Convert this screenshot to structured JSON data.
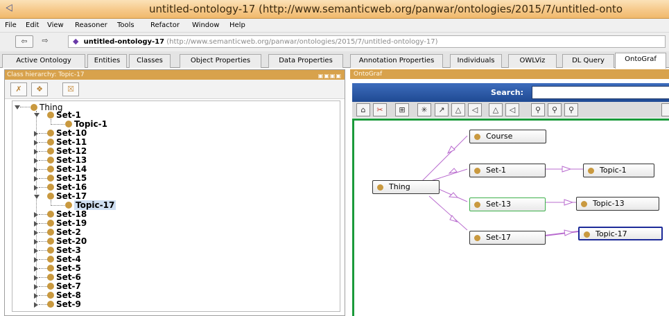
{
  "window": {
    "title": "untitled-ontology-17 (http://www.semanticweb.org/panwar/ontologies/2015/7/untitled-onto"
  },
  "menu": [
    "File",
    "Edit",
    "View",
    "Reasoner",
    "Tools",
    "Refactor",
    "Window",
    "Help"
  ],
  "address": {
    "back_icon": "⇦",
    "forward_icon": "⇨",
    "ontology_name": "untitled-ontology-17",
    "ontology_iri": "(http://www.semanticweb.org/panwar/ontologies/2015/7/untitled-ontology-17)"
  },
  "tabs": [
    {
      "label": "Active Ontology"
    },
    {
      "label": "Entities"
    },
    {
      "label": "Classes"
    },
    {
      "label": "Object Properties"
    },
    {
      "label": "Data Properties"
    },
    {
      "label": "Annotation Properties"
    },
    {
      "label": "Individuals"
    },
    {
      "label": "OWLViz"
    },
    {
      "label": "DL Query"
    },
    {
      "label": "OntoGraf"
    }
  ],
  "active_tab": "OntoGraf",
  "class_hierarchy": {
    "header": "Class hierarchy: Topic-17",
    "root": "Thing",
    "rows": [
      "Set-1",
      "Topic-1",
      "Set-10",
      "Set-11",
      "Set-12",
      "Set-13",
      "Set-14",
      "Set-15",
      "Set-16",
      "Set-17",
      "Topic-17",
      "Set-18",
      "Set-19",
      "Set-2",
      "Set-20",
      "Set-3",
      "Set-4",
      "Set-5",
      "Set-6",
      "Set-7",
      "Set-8",
      "Set-9"
    ],
    "selected": "Topic-17"
  },
  "ontograf": {
    "header": "OntoGraf",
    "search_label": "Search:",
    "search_value": "",
    "nodes": {
      "course": "Course",
      "thing": "Thing",
      "set1": "Set-1",
      "topic1": "Topic-1",
      "set13": "Set-13",
      "topic13": "Topic-13",
      "set17": "Set-17",
      "topic17": "Topic-17"
    }
  },
  "colors": {
    "title_orange": "#f6c98a",
    "panel_header": "#d8a24c",
    "class_dot": "#c9993f",
    "search_blue": "#2b5aa6",
    "canvas_border": "#1a9a3a",
    "edge_purple": "#b96ccf",
    "selected_node_border": "#1c2a98"
  }
}
